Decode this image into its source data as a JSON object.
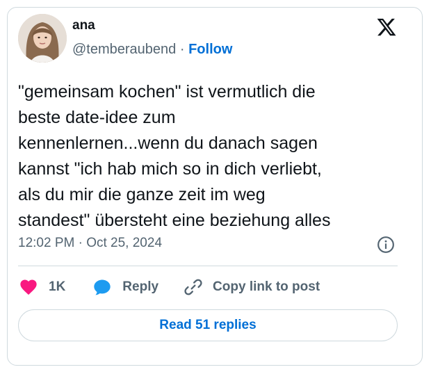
{
  "author": {
    "name": "ana",
    "handle": "@temberaubend",
    "separator": "·",
    "follow_label": "Follow",
    "avatar_icon": "profile-photo"
  },
  "brand_icon": "x-logo-icon",
  "tweet": {
    "lines": [
      "\"gemeinsam kochen\" ist vermutlich die",
      "beste date-idee zum",
      "kennenlernen...wenn du danach sagen",
      "kannst \"ich hab mich so in dich verliebt,",
      "als du mir die ganze zeit im weg",
      "standest\" übersteht eine beziehung alles"
    ],
    "timestamp": "12:02 PM · Oct 25, 2024"
  },
  "actions": {
    "like_count": "1K",
    "reply_label": "Reply",
    "copy_label": "Copy link to post"
  },
  "read_replies_label": "Read 51 replies",
  "colors": {
    "accent": "#006fd6",
    "like": "#f91880",
    "reply": "#1d9bf0",
    "muted": "#536471",
    "border": "#cfd9de"
  }
}
